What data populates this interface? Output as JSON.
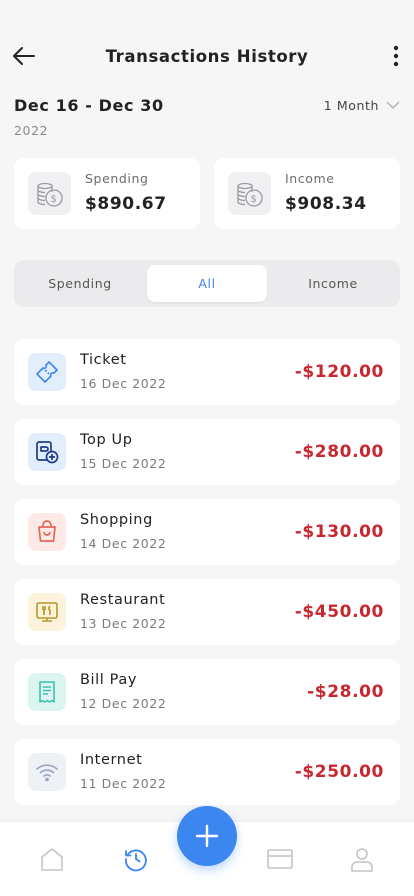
{
  "header": {
    "title": "Transactions History"
  },
  "date_range": {
    "range": "Dec 16 - Dec 30",
    "year": "2022",
    "period": "1 Month"
  },
  "summary": {
    "spending": {
      "label": "Spending",
      "amount": "$890.67"
    },
    "income": {
      "label": "Income",
      "amount": "$908.34"
    }
  },
  "filter_tabs": [
    {
      "label": "Spending",
      "active": false
    },
    {
      "label": "All",
      "active": true
    },
    {
      "label": "Income",
      "active": false
    }
  ],
  "transactions": [
    {
      "name": "Ticket",
      "date": "16 Dec 2022",
      "amount": "-$120.00",
      "icon": "ticket-icon",
      "color": "#3b86ef"
    },
    {
      "name": "Top Up",
      "date": "15 Dec 2022",
      "amount": "-$280.00",
      "icon": "top-up-icon",
      "color": "#1f3d8a"
    },
    {
      "name": "Shopping",
      "date": "14 Dec 2022",
      "amount": "-$130.00",
      "icon": "shopping-bag-icon",
      "color": "#e0685a"
    },
    {
      "name": "Restaurant",
      "date": "13 Dec 2022",
      "amount": "-$450.00",
      "icon": "restaurant-icon",
      "color": "#b8962a"
    },
    {
      "name": "Bill Pay",
      "date": "12 Dec 2022",
      "amount": "-$28.00",
      "icon": "receipt-icon",
      "color": "#3fbfae"
    },
    {
      "name": "Internet",
      "date": "11 Dec 2022",
      "amount": "-$250.00",
      "icon": "wifi-icon",
      "color": "#9aa7bd"
    }
  ],
  "colors": {
    "accent": "#3b86ef",
    "negative_amount": "#c9272f"
  },
  "tabbar": {
    "items": [
      "home-icon",
      "history-icon",
      "card-icon",
      "profile-icon"
    ],
    "active": "history-icon"
  }
}
